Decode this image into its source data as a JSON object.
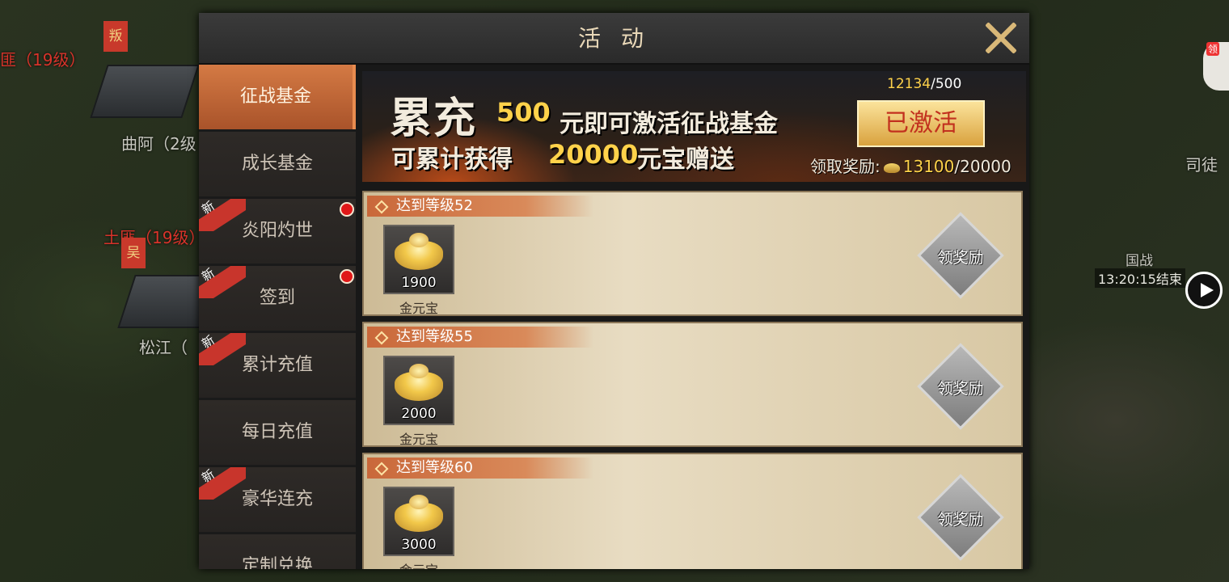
{
  "map": {
    "labels": [
      "匪（19级）",
      "曲阿（2级",
      "土匪（19级）",
      "松江（",
      "司徒",
      "国战"
    ],
    "flags": [
      "叛",
      "吴"
    ],
    "timer": "13:20:15结束",
    "side_badge": "领"
  },
  "dialog": {
    "title": "活 动",
    "tabs": [
      {
        "label": "征战基金",
        "active": true,
        "new": false,
        "dot": false
      },
      {
        "label": "成长基金",
        "active": false,
        "new": false,
        "dot": false
      },
      {
        "label": "炎阳灼世",
        "active": false,
        "new": true,
        "dot": true
      },
      {
        "label": "签到",
        "active": false,
        "new": true,
        "dot": true
      },
      {
        "label": "累计充值",
        "active": false,
        "new": true,
        "dot": false
      },
      {
        "label": "每日充值",
        "active": false,
        "new": false,
        "dot": false
      },
      {
        "label": "豪华连充",
        "active": false,
        "new": true,
        "dot": false
      },
      {
        "label": "定制兑换",
        "active": false,
        "new": false,
        "dot": false
      }
    ],
    "new_tag": "新",
    "banner": {
      "big": "累充",
      "amount": "500",
      "line1": "元即可激活征战基金",
      "line2": "可累计获得",
      "ingots": "20000",
      "line3": "元宝赠送",
      "progress_current": "12134",
      "progress_total": "/500",
      "activated": "已激活",
      "claim_label": "领取奖励:",
      "claim_current": "13100",
      "claim_total": "/20000"
    },
    "rewards": [
      {
        "title": "达到等级52",
        "qty": "1900",
        "item": "金元宝",
        "button": "领奖励"
      },
      {
        "title": "达到等级55",
        "qty": "2000",
        "item": "金元宝",
        "button": "领奖励"
      },
      {
        "title": "达到等级60",
        "qty": "3000",
        "item": "金元宝",
        "button": "领奖励"
      }
    ]
  }
}
